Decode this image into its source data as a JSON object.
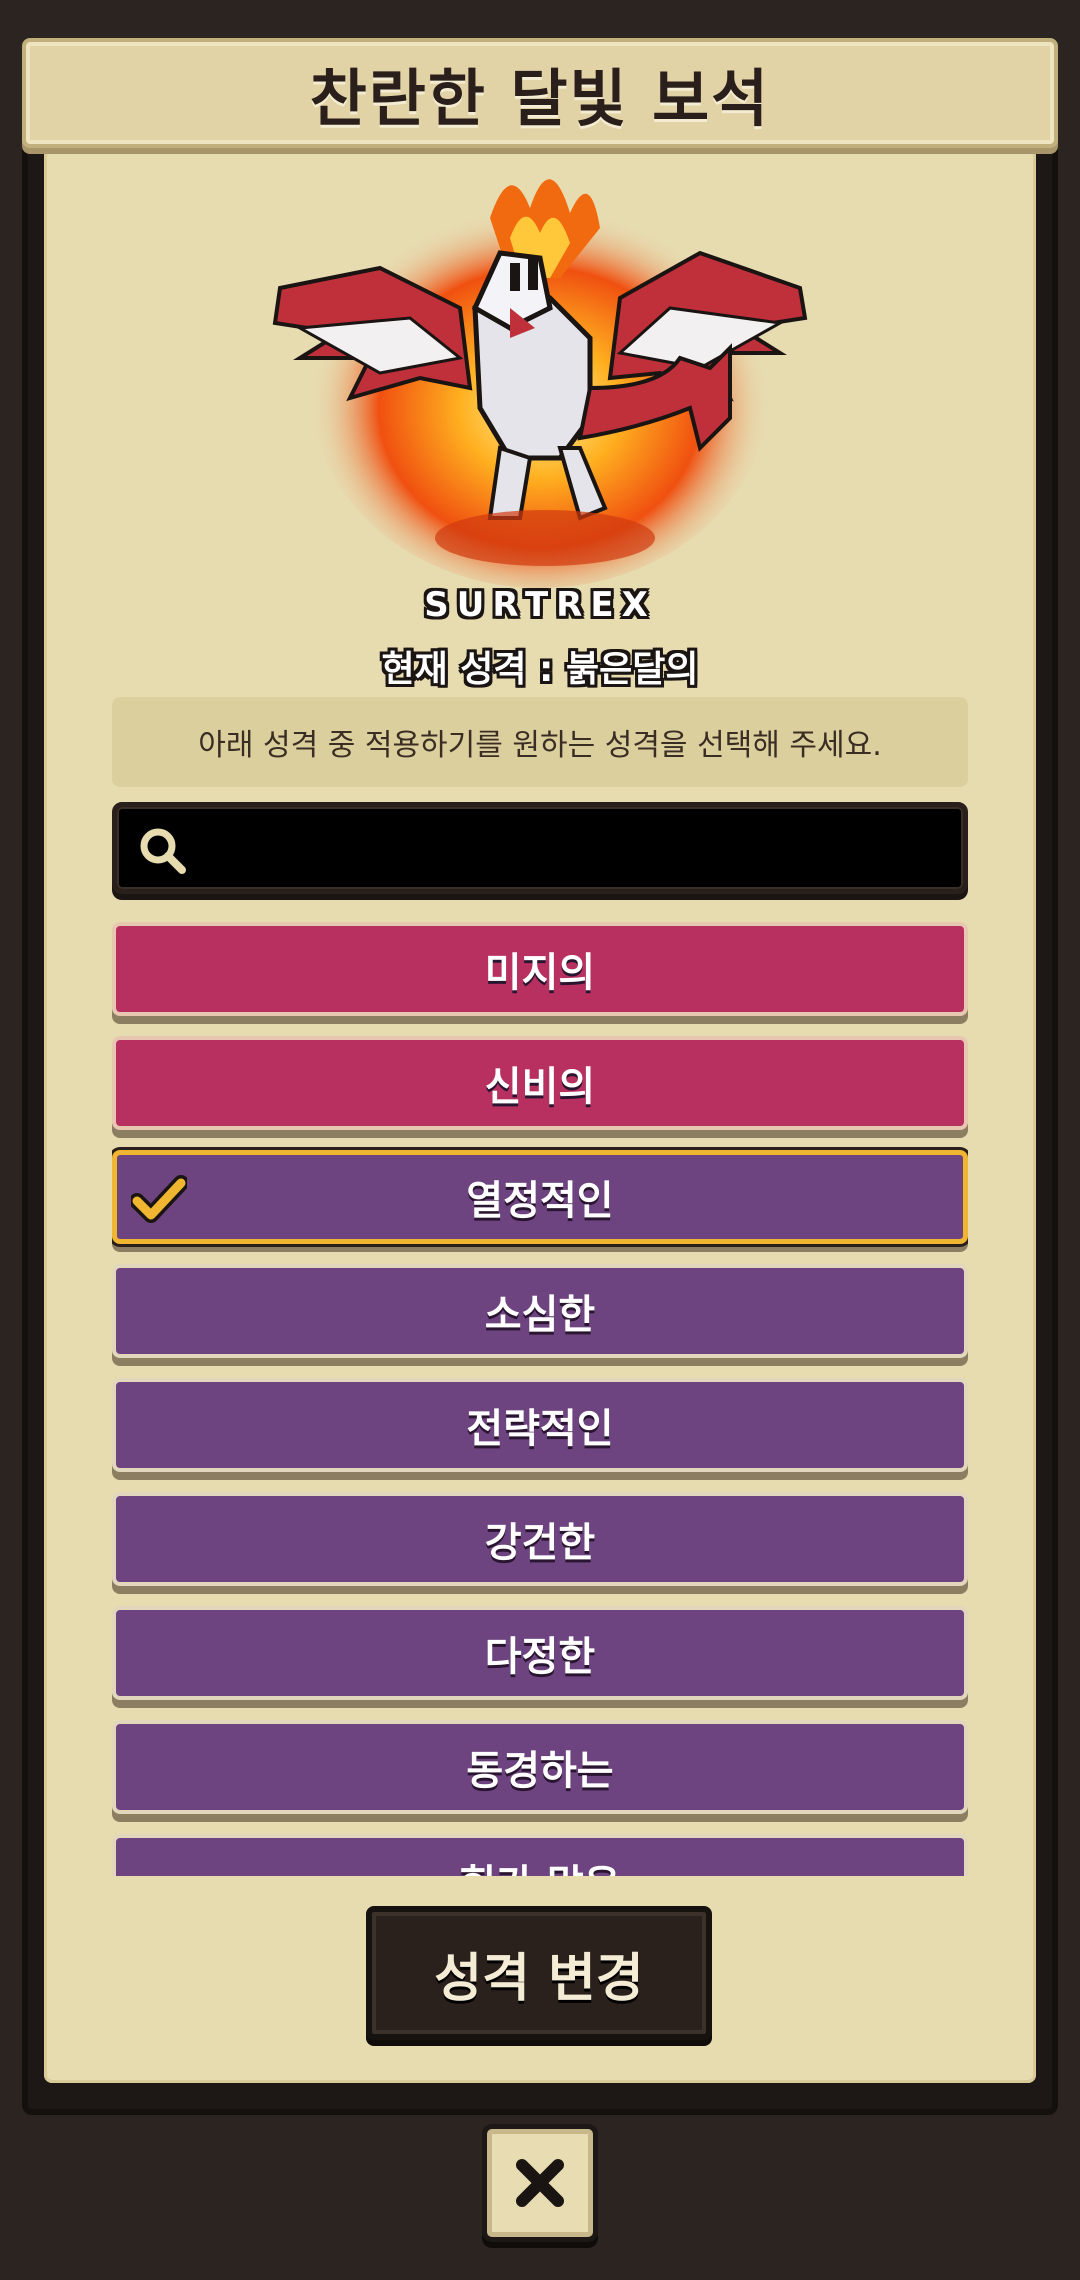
{
  "dialog": {
    "title": "찬란한 달빛 보석"
  },
  "creature": {
    "name": "SURTREX",
    "current_personality": "현재 성격 : 붉은달의"
  },
  "instruction": "아래 성격 중 적용하기를 원하는 성격을 선택해 주세요.",
  "search": {
    "placeholder": "",
    "value": "",
    "icon": "search-icon"
  },
  "personalities": [
    {
      "label": "미지의",
      "style": "pink",
      "selected": false
    },
    {
      "label": "신비의",
      "style": "pink",
      "selected": false
    },
    {
      "label": "열정적인",
      "style": "purple",
      "selected": true
    },
    {
      "label": "소심한",
      "style": "purple",
      "selected": false
    },
    {
      "label": "전략적인",
      "style": "purple",
      "selected": false
    },
    {
      "label": "강건한",
      "style": "purple",
      "selected": false
    },
    {
      "label": "다정한",
      "style": "purple",
      "selected": false
    },
    {
      "label": "동경하는",
      "style": "purple",
      "selected": false
    },
    {
      "label": "힘가 많은",
      "style": "purple",
      "selected": false
    }
  ],
  "buttons": {
    "change_label": "성격 변경",
    "close_icon": "close-icon"
  },
  "colors": {
    "paper": "#e7dbb0",
    "pink_item": "#b8305f",
    "purple_item": "#6d4480",
    "selected_border": "#f0b632"
  }
}
